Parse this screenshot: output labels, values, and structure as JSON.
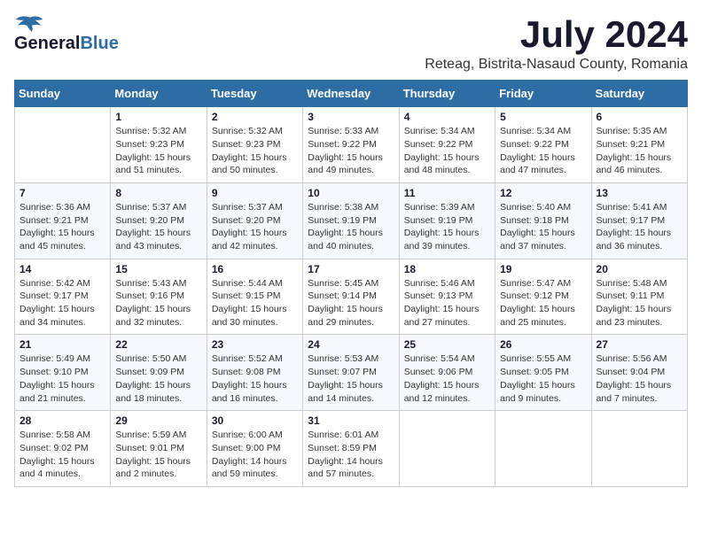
{
  "header": {
    "logo_general": "General",
    "logo_blue": "Blue",
    "month_title": "July 2024",
    "location": "Reteag, Bistrita-Nasaud County, Romania"
  },
  "calendar": {
    "days_of_week": [
      "Sunday",
      "Monday",
      "Tuesday",
      "Wednesday",
      "Thursday",
      "Friday",
      "Saturday"
    ],
    "weeks": [
      [
        {
          "day": "",
          "info": ""
        },
        {
          "day": "1",
          "info": "Sunrise: 5:32 AM\nSunset: 9:23 PM\nDaylight: 15 hours\nand 51 minutes."
        },
        {
          "day": "2",
          "info": "Sunrise: 5:32 AM\nSunset: 9:23 PM\nDaylight: 15 hours\nand 50 minutes."
        },
        {
          "day": "3",
          "info": "Sunrise: 5:33 AM\nSunset: 9:22 PM\nDaylight: 15 hours\nand 49 minutes."
        },
        {
          "day": "4",
          "info": "Sunrise: 5:34 AM\nSunset: 9:22 PM\nDaylight: 15 hours\nand 48 minutes."
        },
        {
          "day": "5",
          "info": "Sunrise: 5:34 AM\nSunset: 9:22 PM\nDaylight: 15 hours\nand 47 minutes."
        },
        {
          "day": "6",
          "info": "Sunrise: 5:35 AM\nSunset: 9:21 PM\nDaylight: 15 hours\nand 46 minutes."
        }
      ],
      [
        {
          "day": "7",
          "info": "Sunrise: 5:36 AM\nSunset: 9:21 PM\nDaylight: 15 hours\nand 45 minutes."
        },
        {
          "day": "8",
          "info": "Sunrise: 5:37 AM\nSunset: 9:20 PM\nDaylight: 15 hours\nand 43 minutes."
        },
        {
          "day": "9",
          "info": "Sunrise: 5:37 AM\nSunset: 9:20 PM\nDaylight: 15 hours\nand 42 minutes."
        },
        {
          "day": "10",
          "info": "Sunrise: 5:38 AM\nSunset: 9:19 PM\nDaylight: 15 hours\nand 40 minutes."
        },
        {
          "day": "11",
          "info": "Sunrise: 5:39 AM\nSunset: 9:19 PM\nDaylight: 15 hours\nand 39 minutes."
        },
        {
          "day": "12",
          "info": "Sunrise: 5:40 AM\nSunset: 9:18 PM\nDaylight: 15 hours\nand 37 minutes."
        },
        {
          "day": "13",
          "info": "Sunrise: 5:41 AM\nSunset: 9:17 PM\nDaylight: 15 hours\nand 36 minutes."
        }
      ],
      [
        {
          "day": "14",
          "info": "Sunrise: 5:42 AM\nSunset: 9:17 PM\nDaylight: 15 hours\nand 34 minutes."
        },
        {
          "day": "15",
          "info": "Sunrise: 5:43 AM\nSunset: 9:16 PM\nDaylight: 15 hours\nand 32 minutes."
        },
        {
          "day": "16",
          "info": "Sunrise: 5:44 AM\nSunset: 9:15 PM\nDaylight: 15 hours\nand 30 minutes."
        },
        {
          "day": "17",
          "info": "Sunrise: 5:45 AM\nSunset: 9:14 PM\nDaylight: 15 hours\nand 29 minutes."
        },
        {
          "day": "18",
          "info": "Sunrise: 5:46 AM\nSunset: 9:13 PM\nDaylight: 15 hours\nand 27 minutes."
        },
        {
          "day": "19",
          "info": "Sunrise: 5:47 AM\nSunset: 9:12 PM\nDaylight: 15 hours\nand 25 minutes."
        },
        {
          "day": "20",
          "info": "Sunrise: 5:48 AM\nSunset: 9:11 PM\nDaylight: 15 hours\nand 23 minutes."
        }
      ],
      [
        {
          "day": "21",
          "info": "Sunrise: 5:49 AM\nSunset: 9:10 PM\nDaylight: 15 hours\nand 21 minutes."
        },
        {
          "day": "22",
          "info": "Sunrise: 5:50 AM\nSunset: 9:09 PM\nDaylight: 15 hours\nand 18 minutes."
        },
        {
          "day": "23",
          "info": "Sunrise: 5:52 AM\nSunset: 9:08 PM\nDaylight: 15 hours\nand 16 minutes."
        },
        {
          "day": "24",
          "info": "Sunrise: 5:53 AM\nSunset: 9:07 PM\nDaylight: 15 hours\nand 14 minutes."
        },
        {
          "day": "25",
          "info": "Sunrise: 5:54 AM\nSunset: 9:06 PM\nDaylight: 15 hours\nand 12 minutes."
        },
        {
          "day": "26",
          "info": "Sunrise: 5:55 AM\nSunset: 9:05 PM\nDaylight: 15 hours\nand 9 minutes."
        },
        {
          "day": "27",
          "info": "Sunrise: 5:56 AM\nSunset: 9:04 PM\nDaylight: 15 hours\nand 7 minutes."
        }
      ],
      [
        {
          "day": "28",
          "info": "Sunrise: 5:58 AM\nSunset: 9:02 PM\nDaylight: 15 hours\nand 4 minutes."
        },
        {
          "day": "29",
          "info": "Sunrise: 5:59 AM\nSunset: 9:01 PM\nDaylight: 15 hours\nand 2 minutes."
        },
        {
          "day": "30",
          "info": "Sunrise: 6:00 AM\nSunset: 9:00 PM\nDaylight: 14 hours\nand 59 minutes."
        },
        {
          "day": "31",
          "info": "Sunrise: 6:01 AM\nSunset: 8:59 PM\nDaylight: 14 hours\nand 57 minutes."
        },
        {
          "day": "",
          "info": ""
        },
        {
          "day": "",
          "info": ""
        },
        {
          "day": "",
          "info": ""
        }
      ]
    ]
  }
}
